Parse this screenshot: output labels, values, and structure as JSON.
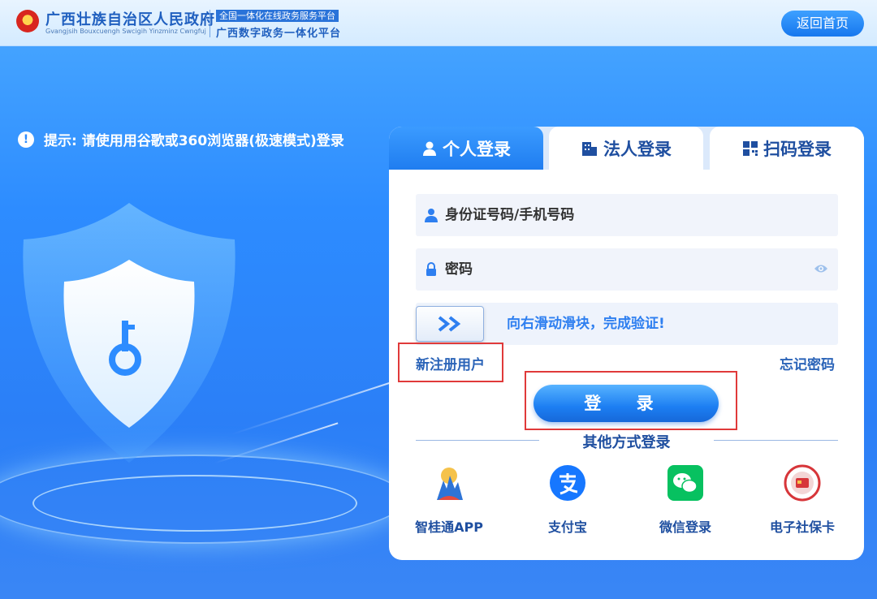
{
  "header": {
    "gov_title": "广西壮族自治区人民政府",
    "gov_subtitle": "Gvangjsih Bouxcuengh Swcigih Yinzminz Cwngfuj",
    "platform_badge": "全国一体化在线政务服务平台",
    "platform_name": "广西数字政务一体化平台",
    "back_home": "返回首页"
  },
  "notice": {
    "icon": "!",
    "text": "提示: 请使用用谷歌或360浏览器(极速模式)登录"
  },
  "tabs": [
    {
      "label": "个人登录",
      "active": true
    },
    {
      "label": "法人登录",
      "active": false
    },
    {
      "label": "扫码登录",
      "active": false
    }
  ],
  "form": {
    "username_placeholder": "身份证号码/手机号码",
    "password_placeholder": "密码",
    "slider_text": "向右滑动滑块，完成验证!",
    "register": "新注册用户",
    "forgot": "忘记密码",
    "login": "登 录"
  },
  "other_login": {
    "title": "其他方式登录",
    "methods": [
      {
        "label": "智桂通APP",
        "icon": "zhiguitong-icon"
      },
      {
        "label": "支付宝",
        "icon": "alipay-icon"
      },
      {
        "label": "微信登录",
        "icon": "wechat-icon"
      },
      {
        "label": "电子社保卡",
        "icon": "social-security-card-icon"
      }
    ]
  },
  "colors": {
    "primary": "#1f7df0",
    "highlight": "#e03a3a",
    "background": "#2d8cff"
  }
}
